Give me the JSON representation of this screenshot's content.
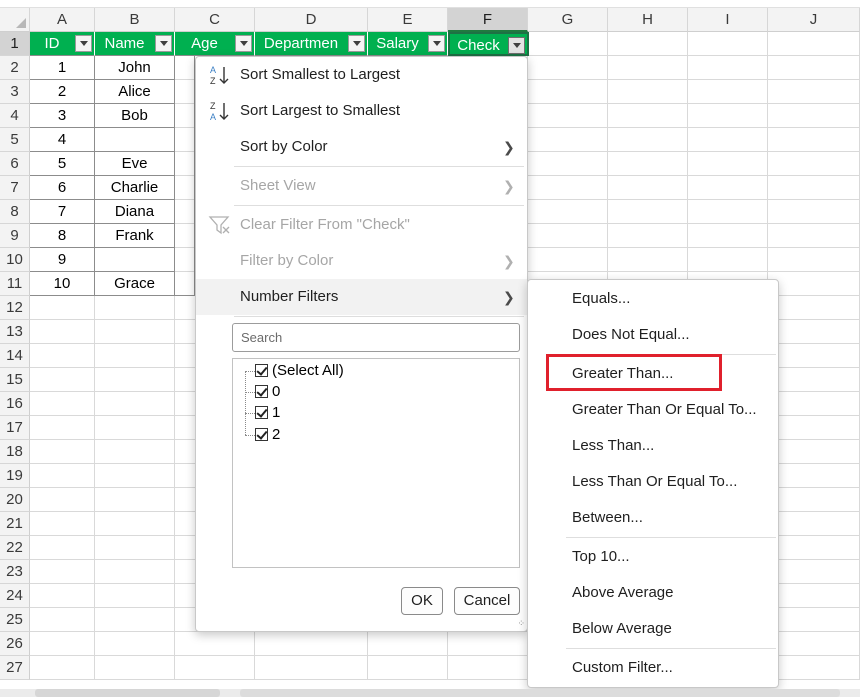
{
  "columns": [
    "A",
    "B",
    "C",
    "D",
    "E",
    "F",
    "G",
    "H",
    "I",
    "J"
  ],
  "rows": [
    "1",
    "2",
    "3",
    "4",
    "5",
    "6",
    "7",
    "8",
    "9",
    "10",
    "11",
    "12",
    "13",
    "14",
    "15",
    "16",
    "17",
    "18",
    "19",
    "20",
    "21",
    "22",
    "23",
    "24",
    "25",
    "26",
    "27"
  ],
  "header_cells": [
    "ID",
    "Name",
    "Age",
    "Departmen",
    "Salary",
    "Check"
  ],
  "data_rows": [
    {
      "id": "1",
      "name": "John"
    },
    {
      "id": "2",
      "name": "Alice"
    },
    {
      "id": "3",
      "name": "Bob"
    },
    {
      "id": "4",
      "name": ""
    },
    {
      "id": "5",
      "name": "Eve"
    },
    {
      "id": "6",
      "name": "Charlie"
    },
    {
      "id": "7",
      "name": "Diana"
    },
    {
      "id": "8",
      "name": "Frank"
    },
    {
      "id": "9",
      "name": ""
    },
    {
      "id": "10",
      "name": "Grace"
    }
  ],
  "menu": {
    "sort_asc": "Sort Smallest to Largest",
    "sort_desc": "Sort Largest to Smallest",
    "sort_by_color": "Sort by Color",
    "sheet_view": "Sheet View",
    "clear_filter": "Clear Filter From \"Check\"",
    "filter_by_color": "Filter by Color",
    "number_filters": "Number Filters",
    "search_placeholder": "Search",
    "list_items": [
      "(Select All)",
      "0",
      "1",
      "2"
    ],
    "ok": "OK",
    "cancel": "Cancel",
    "icon_az_top": "A",
    "icon_az_bottom": "Z",
    "icon_za_top": "Z",
    "icon_za_bottom": "A"
  },
  "submenu": {
    "items": [
      "Equals...",
      "Does Not Equal...",
      "Greater Than...",
      "Greater Than Or Equal To...",
      "Less Than...",
      "Less Than Or Equal To...",
      "Between...",
      "Top 10...",
      "Above Average",
      "Below Average",
      "Custom Filter..."
    ]
  },
  "colors": {
    "header_green": "#00b050",
    "highlight_red": "#e0202c"
  }
}
